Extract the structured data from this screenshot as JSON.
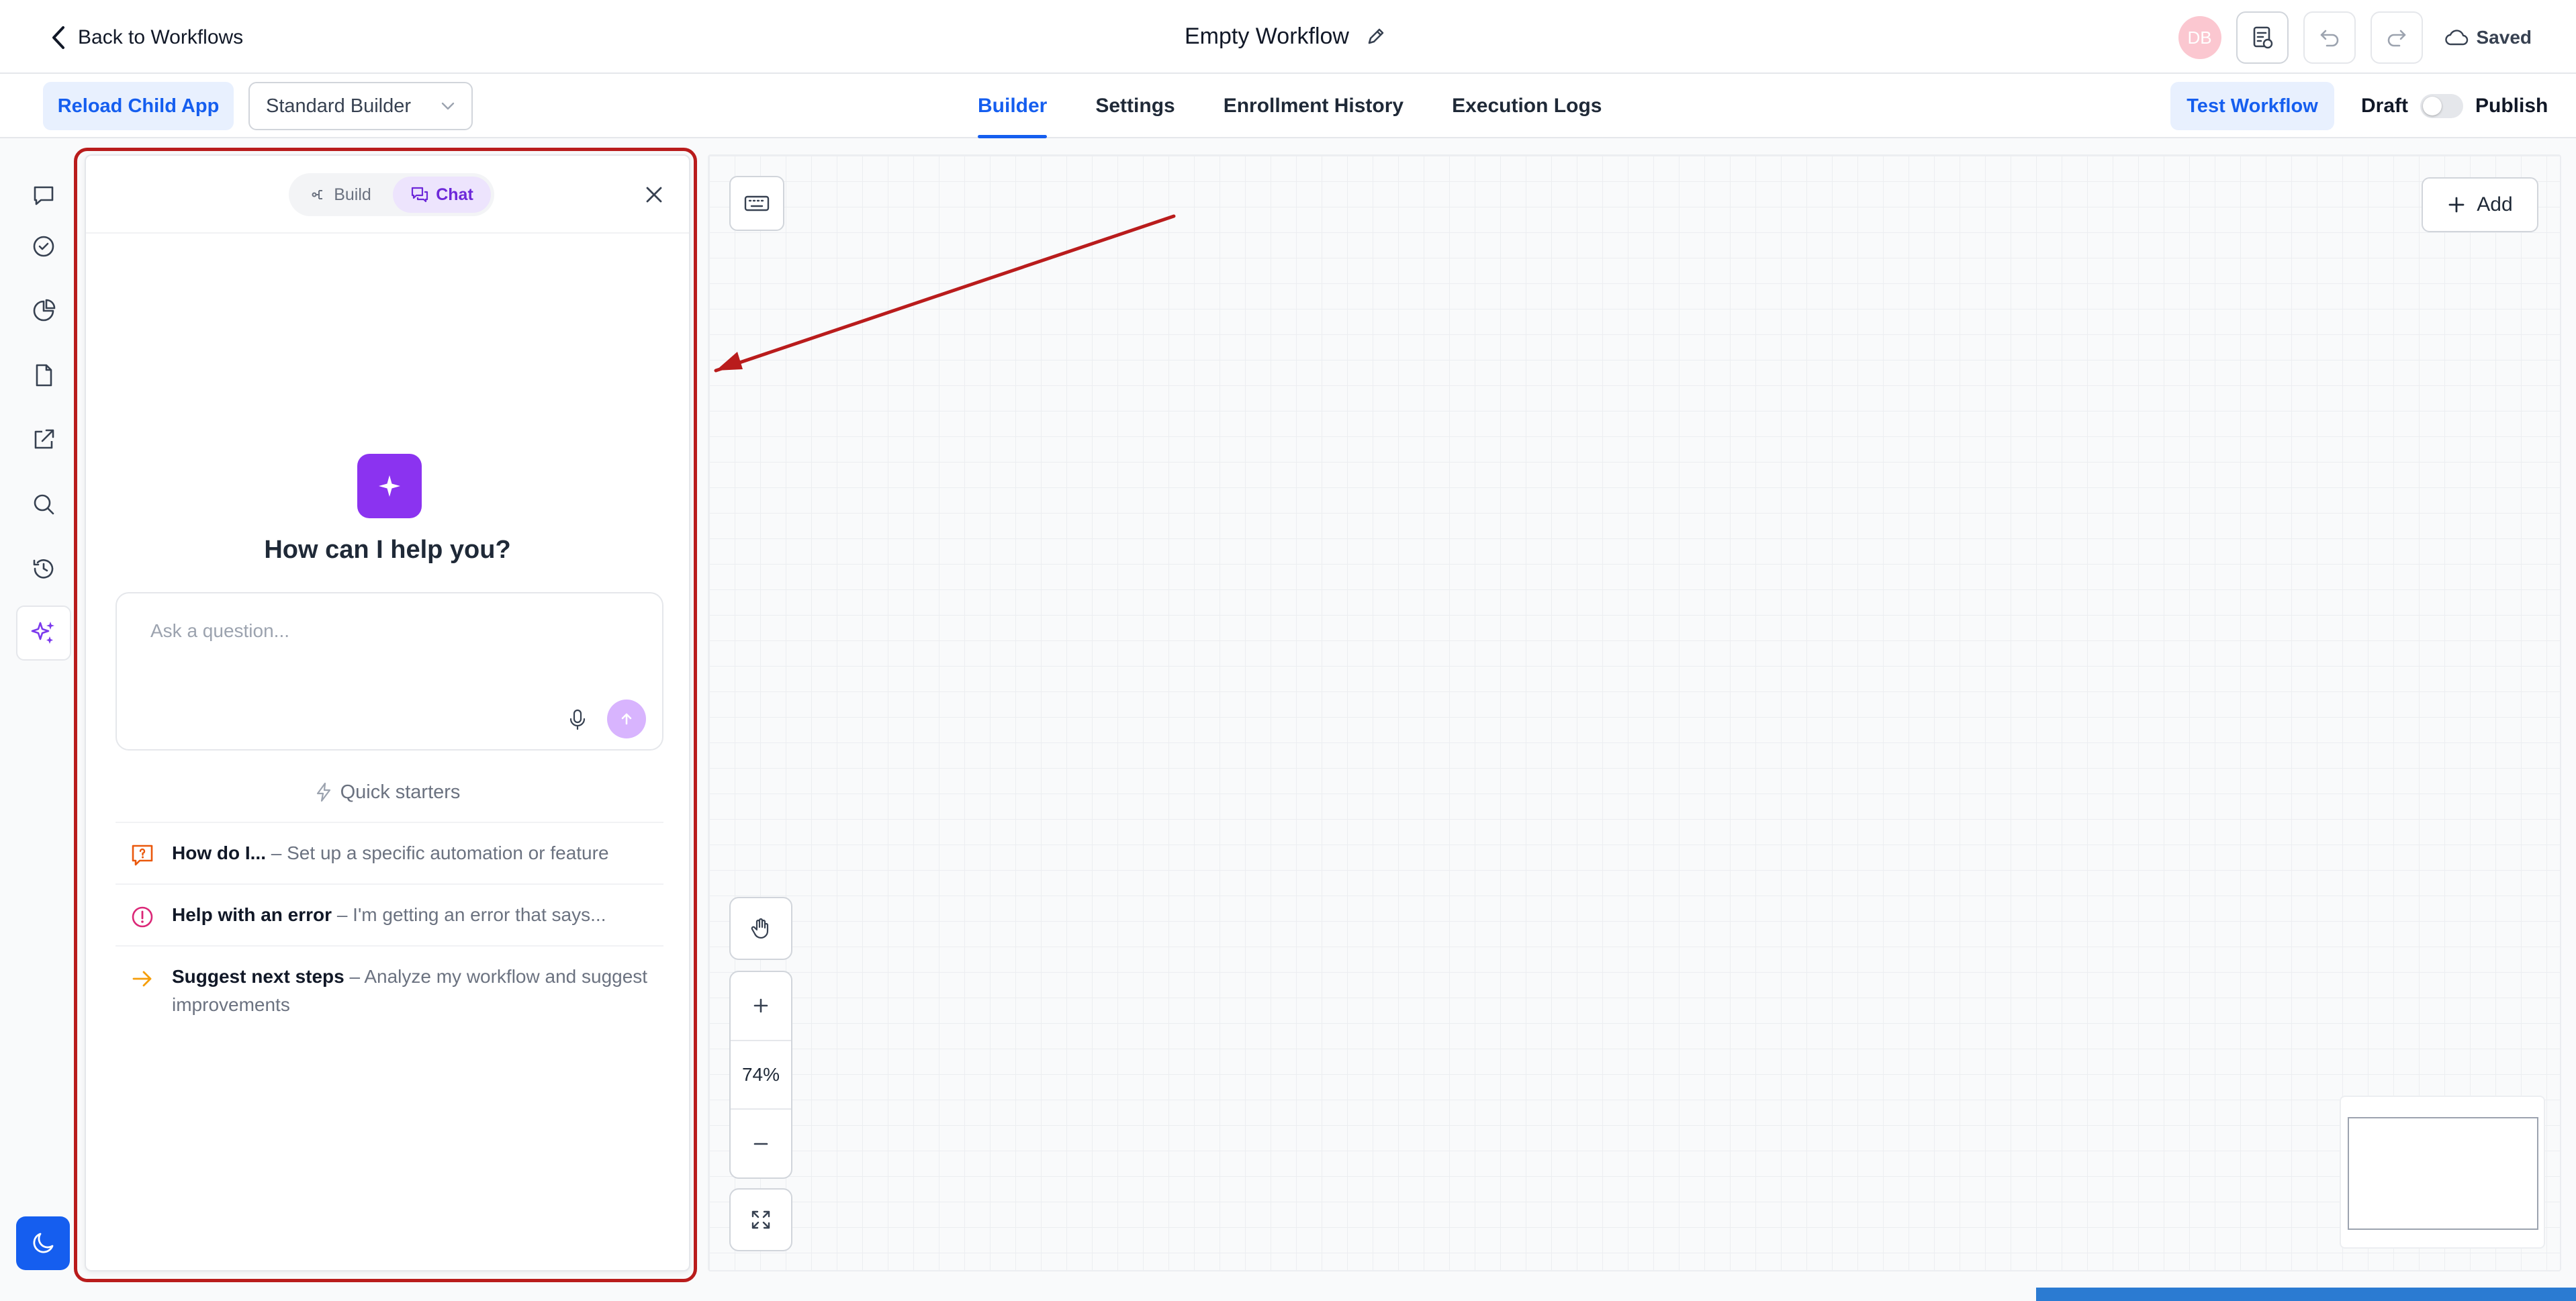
{
  "header": {
    "back_label": "Back to Workflows",
    "workflow_title": "Empty Workflow",
    "avatar_initials": "DB",
    "saved_label": "Saved"
  },
  "toolbar": {
    "reload_label": "Reload Child App",
    "builder_select_value": "Standard Builder",
    "tabs": [
      {
        "label": "Builder",
        "active": true
      },
      {
        "label": "Settings",
        "active": false
      },
      {
        "label": "Enrollment History",
        "active": false
      },
      {
        "label": "Execution Logs",
        "active": false
      }
    ],
    "test_label": "Test Workflow",
    "draft_label": "Draft",
    "publish_label": "Publish",
    "publish_toggle_on": false
  },
  "rail": {
    "items": [
      {
        "icon": "chat-icon"
      },
      {
        "icon": "check-circle-icon"
      },
      {
        "icon": "pie-chart-icon"
      },
      {
        "icon": "document-icon"
      },
      {
        "icon": "external-link-icon"
      },
      {
        "icon": "search-icon"
      },
      {
        "icon": "history-icon"
      },
      {
        "icon": "sparkle-icon",
        "active": true
      }
    ],
    "bottom_icon": "moon-icon"
  },
  "chat_panel": {
    "mode_tabs": [
      {
        "label": "Build",
        "active": false
      },
      {
        "label": "Chat",
        "active": true
      }
    ],
    "heading": "How can I help you?",
    "input_placeholder": "Ask a question...",
    "input_value": "",
    "quick_starters_title": "Quick starters",
    "quick_starters": [
      {
        "title": "How do I...",
        "desc": "– Set up a specific automation or feature",
        "icon": "question-bubble-icon",
        "color": "#ea580c"
      },
      {
        "title": "Help with an error",
        "desc": "– I'm getting an error that says...",
        "icon": "alert-circle-icon",
        "color": "#db2777"
      },
      {
        "title": "Suggest next steps",
        "desc": "– Analyze my workflow and suggest improvements",
        "icon": "arrow-right-icon",
        "color": "#f59e0b"
      }
    ]
  },
  "canvas": {
    "add_label": "Add",
    "zoom_level": "74%"
  },
  "colors": {
    "accent": "#155eef",
    "ai_purple": "#8b33f0",
    "annotation_red": "#b91c1c"
  }
}
